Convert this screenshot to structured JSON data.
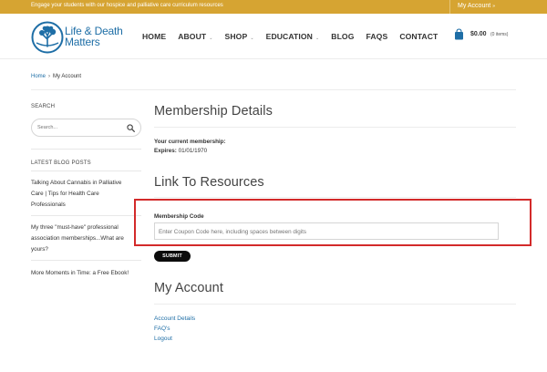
{
  "topbar": {
    "promo": "Engage your students with our hospice and palliative care curriculum resources",
    "account_label": "My Account",
    "account_chevron": "»"
  },
  "logo": {
    "line1": "Life & Death",
    "line2": "Matters",
    "icon": "tree-globe-logo",
    "brand_blue": "#1e6ea6"
  },
  "nav": {
    "items": [
      {
        "label": "HOME",
        "has_dropdown": false
      },
      {
        "label": "ABOUT",
        "has_dropdown": true
      },
      {
        "label": "SHOP",
        "has_dropdown": true
      },
      {
        "label": "EDUCATION",
        "has_dropdown": true
      },
      {
        "label": "BLOG",
        "has_dropdown": false
      },
      {
        "label": "FAQS",
        "has_dropdown": false
      },
      {
        "label": "CONTACT",
        "has_dropdown": false
      }
    ],
    "caret": "⌄"
  },
  "cart": {
    "amount": "$0.00",
    "items": "(0 items)",
    "icon": "shopping-bag-icon"
  },
  "breadcrumb": {
    "home": "Home",
    "separator": "›",
    "current": "My Account"
  },
  "sidebar": {
    "search_heading": "SEARCH",
    "search_placeholder": "Search...",
    "latest_heading": "LATEST BLOG POSTS",
    "posts": [
      {
        "line1": "Talking About Cannabis in Palliative",
        "line2": "Care | Tips for Health Care",
        "line3": "Professionals"
      },
      {
        "line1": "My three \"must-have\" professional",
        "line2": "association memberships...What are",
        "line3": "yours?"
      },
      {
        "line1": "More Moments in Time: a Free Ebook!"
      }
    ]
  },
  "main": {
    "membership_title": "Membership Details",
    "current_membership_label": "Your current membership:",
    "expires_label": "Expires:",
    "expires_value": "01/01/1970",
    "resources_title": "Link To Resources",
    "code_label": "Membership Code",
    "code_placeholder": "Enter Coupon Code here, including spaces between digits",
    "submit_label": "SUBMIT",
    "account_title": "My Account",
    "account_links": [
      "Account Details",
      "FAQ's",
      "Logout"
    ]
  },
  "colors": {
    "topbar": "#d6a432",
    "highlight": "#d32a2a",
    "link": "#1e6ea6"
  }
}
